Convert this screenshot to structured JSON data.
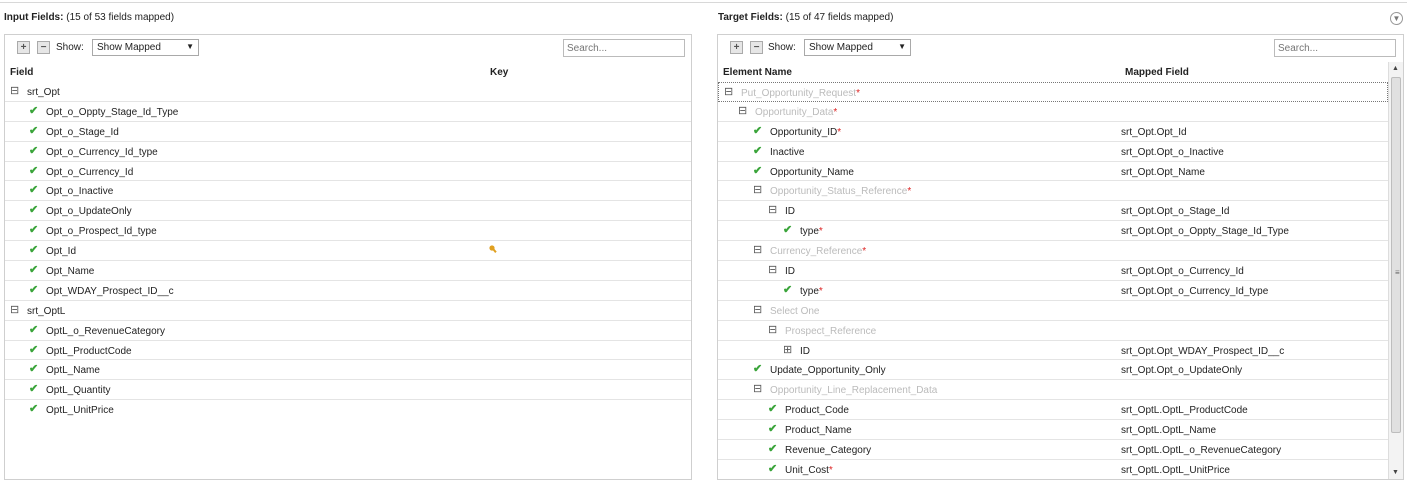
{
  "input": {
    "title": "Input Fields:",
    "summary": "(15 of 53 fields mapped)",
    "show_label": "Show:",
    "show_value": "Show Mapped",
    "search_placeholder": "Search...",
    "columns": [
      "Field",
      "Key"
    ],
    "rows": [
      {
        "label": "srt_Opt",
        "kind": "group",
        "level": 0
      },
      {
        "label": "Opt_o_Oppty_Stage_Id_Type",
        "kind": "check",
        "level": 1
      },
      {
        "label": "Opt_o_Stage_Id",
        "kind": "check",
        "level": 1
      },
      {
        "label": "Opt_o_Currency_Id_type",
        "kind": "check",
        "level": 1
      },
      {
        "label": "Opt_o_Currency_Id",
        "kind": "check",
        "level": 1
      },
      {
        "label": "Opt_o_Inactive",
        "kind": "check",
        "level": 1
      },
      {
        "label": "Opt_o_UpdateOnly",
        "kind": "check",
        "level": 1
      },
      {
        "label": "Opt_o_Prospect_Id_type",
        "kind": "check",
        "level": 1
      },
      {
        "label": "Opt_Id",
        "kind": "check",
        "level": 1,
        "key": true
      },
      {
        "label": "Opt_Name",
        "kind": "check",
        "level": 1
      },
      {
        "label": "Opt_WDAY_Prospect_ID__c",
        "kind": "check",
        "level": 1
      },
      {
        "label": "srt_OptL",
        "kind": "group",
        "level": 0
      },
      {
        "label": "OptL_o_RevenueCategory",
        "kind": "check",
        "level": 1
      },
      {
        "label": "OptL_ProductCode",
        "kind": "check",
        "level": 1
      },
      {
        "label": "OptL_Name",
        "kind": "check",
        "level": 1
      },
      {
        "label": "OptL_Quantity",
        "kind": "check",
        "level": 1
      },
      {
        "label": "OptL_UnitPrice",
        "kind": "check",
        "level": 1
      }
    ]
  },
  "target": {
    "title": "Target Fields:",
    "summary": "(15 of 47 fields mapped)",
    "show_label": "Show:",
    "show_value": "Show Mapped",
    "search_placeholder": "Search...",
    "columns": [
      "Element Name",
      "Mapped Field"
    ],
    "rows": [
      {
        "label": "Put_Opportunity_Request",
        "kind": "group",
        "muted": true,
        "req": true,
        "level": 0,
        "mapped": ""
      },
      {
        "label": "Opportunity_Data",
        "kind": "group",
        "muted": true,
        "req": true,
        "level": 1,
        "mapped": ""
      },
      {
        "label": "Opportunity_ID",
        "kind": "check",
        "req": true,
        "level": 2,
        "mapped": "srt_Opt.Opt_Id"
      },
      {
        "label": "Inactive",
        "kind": "check",
        "level": 2,
        "mapped": "srt_Opt.Opt_o_Inactive"
      },
      {
        "label": "Opportunity_Name",
        "kind": "check",
        "level": 2,
        "mapped": "srt_Opt.Opt_Name"
      },
      {
        "label": "Opportunity_Status_Reference",
        "kind": "group",
        "muted": true,
        "req": true,
        "level": 2,
        "mapped": ""
      },
      {
        "label": "ID",
        "kind": "group",
        "level": 3,
        "mapped": "srt_Opt.Opt_o_Stage_Id"
      },
      {
        "label": "type",
        "kind": "check",
        "req": true,
        "level": 4,
        "mapped": "srt_Opt.Opt_o_Oppty_Stage_Id_Type"
      },
      {
        "label": "Currency_Reference",
        "kind": "group",
        "muted": true,
        "req": true,
        "level": 2,
        "mapped": ""
      },
      {
        "label": "ID",
        "kind": "group",
        "level": 3,
        "mapped": "srt_Opt.Opt_o_Currency_Id"
      },
      {
        "label": "type",
        "kind": "check",
        "req": true,
        "level": 4,
        "mapped": "srt_Opt.Opt_o_Currency_Id_type"
      },
      {
        "label": "Select One",
        "kind": "group",
        "muted": true,
        "level": 2,
        "mapped": ""
      },
      {
        "label": "Prospect_Reference",
        "kind": "group",
        "muted": true,
        "level": 3,
        "mapped": ""
      },
      {
        "label": "ID",
        "kind": "plus",
        "level": 4,
        "mapped": "srt_Opt.Opt_WDAY_Prospect_ID__c"
      },
      {
        "label": "Update_Opportunity_Only",
        "kind": "check",
        "level": 2,
        "mapped": "srt_Opt.Opt_o_UpdateOnly"
      },
      {
        "label": "Opportunity_Line_Replacement_Data",
        "kind": "group",
        "muted": true,
        "level": 2,
        "mapped": ""
      },
      {
        "label": "Product_Code",
        "kind": "check",
        "level": 3,
        "mapped": "srt_OptL.OptL_ProductCode"
      },
      {
        "label": "Product_Name",
        "kind": "check",
        "level": 3,
        "mapped": "srt_OptL.OptL_Name"
      },
      {
        "label": "Revenue_Category",
        "kind": "check",
        "level": 3,
        "mapped": "srt_OptL.OptL_o_RevenueCategory"
      },
      {
        "label": "Unit_Cost",
        "kind": "check",
        "req": true,
        "level": 3,
        "mapped": "srt_OptL.OptL_UnitPrice"
      }
    ]
  },
  "icons": {
    "expand_all": "expand-all-icon",
    "collapse_all": "collapse-all-icon",
    "check": "check-icon",
    "minus": "collapse-node-icon",
    "plus": "expand-node-icon",
    "key": "key-icon"
  },
  "colors": {
    "check": "#3aa43a",
    "required": "#dd2222",
    "muted": "#bbbbbb",
    "key": "#e0a020"
  }
}
